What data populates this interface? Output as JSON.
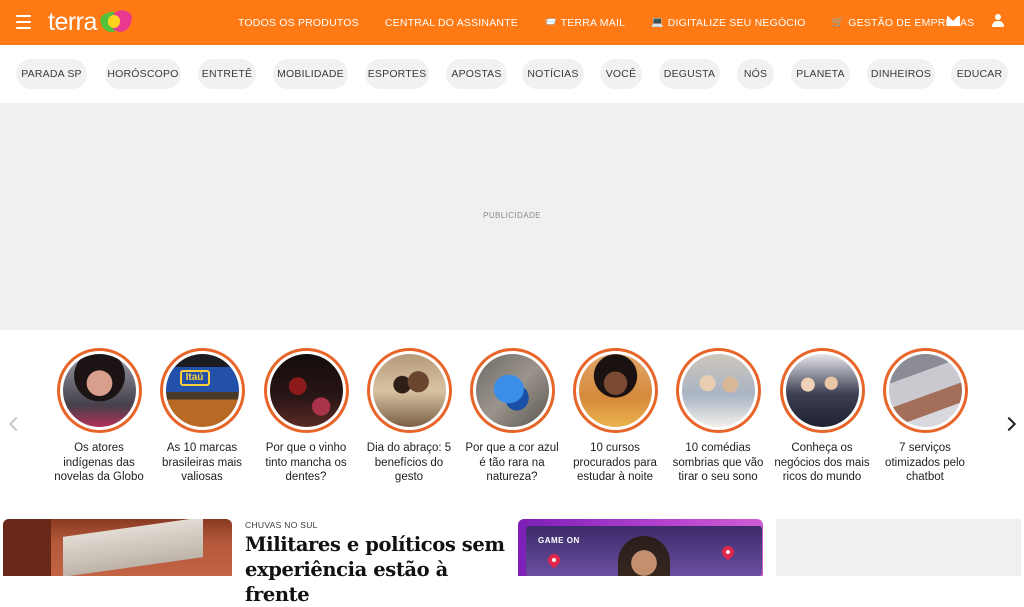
{
  "brand": {
    "name": "terra"
  },
  "topnav": [
    {
      "label": "TODOS OS PRODUTOS",
      "icon": ""
    },
    {
      "label": "CENTRAL DO ASSINANTE",
      "icon": ""
    },
    {
      "label": "TERRA MAIL",
      "icon": "📨"
    },
    {
      "label": "DIGITALIZE SEU NEGÓCIO",
      "icon": "💻"
    },
    {
      "label": "GESTÃO DE EMPRESAS",
      "icon": "🛒"
    }
  ],
  "categories": [
    "PARADA SP",
    "HORÓSCOPO",
    "ENTRETÊ",
    "MOBILIDADE",
    "ESPORTES",
    "APOSTAS",
    "NOTÍCIAS",
    "VOCÊ",
    "DEGUSTA",
    "NÓS",
    "PLANETA",
    "DINHEIROS",
    "EDUCAR"
  ],
  "ad": {
    "label": "PUBLICIDADE"
  },
  "stories": [
    {
      "caption": "Os atores indígenas das novelas da Globo"
    },
    {
      "caption": "As 10 marcas brasileiras mais valiosas",
      "logo_text": "Itaú"
    },
    {
      "caption": "Por que o vinho tinto mancha os dentes?"
    },
    {
      "caption": "Dia do abraço: 5 benefícios do gesto"
    },
    {
      "caption": "Por que a cor azul é tão rara na natureza?"
    },
    {
      "caption": "10 cursos procurados para estudar à noite"
    },
    {
      "caption": "10 comédias sombrias que vão tirar o seu sono"
    },
    {
      "caption": "Conheça os negócios dos mais ricos do mundo"
    },
    {
      "caption": "7 serviços otimizados pelo chatbot"
    }
  ],
  "feature": {
    "kicker": "CHUVAS NO SUL",
    "headline": "Militares e políticos sem experiência estão à frente"
  },
  "promo": {
    "title": "GAME ON"
  },
  "colors": {
    "brand_orange": "#ff7a14",
    "story_ring": "#e8652a",
    "pill_bg": "#f1f1f1",
    "ad_bg": "#f0f0f0"
  }
}
